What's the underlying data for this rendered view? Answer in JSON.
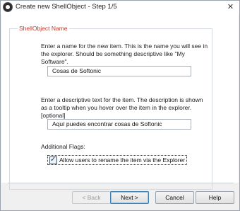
{
  "window": {
    "title": "Create new ShellObject - Step 1/5",
    "close_glyph": "✕",
    "app_icon": "app-logo-icon"
  },
  "group": {
    "legend": "ShellObject Name"
  },
  "name_section": {
    "description": "Enter a name for the new item. This is the name you will see in the explorer. Should be something descriptive like \"My Software\".",
    "value": "Cosas de Softonic"
  },
  "tooltip_section": {
    "description": "Enter a descriptive text for the item. The description is shown as a tooltip when you hover over the item in the explorer. [optional]",
    "value": "Aquí puedes encontrar cosas de Softonic"
  },
  "flags": {
    "label": "Additional Flags:",
    "rename_label": "Allow users to rename the item via the Explorer",
    "rename_checked": true,
    "check_glyph": "✓"
  },
  "buttons": {
    "back": "< Back",
    "next": "Next >",
    "cancel": "Cancel",
    "help": "Help"
  },
  "colors": {
    "legend": "#c0392b",
    "default_button_border": "#3c7fb1"
  }
}
